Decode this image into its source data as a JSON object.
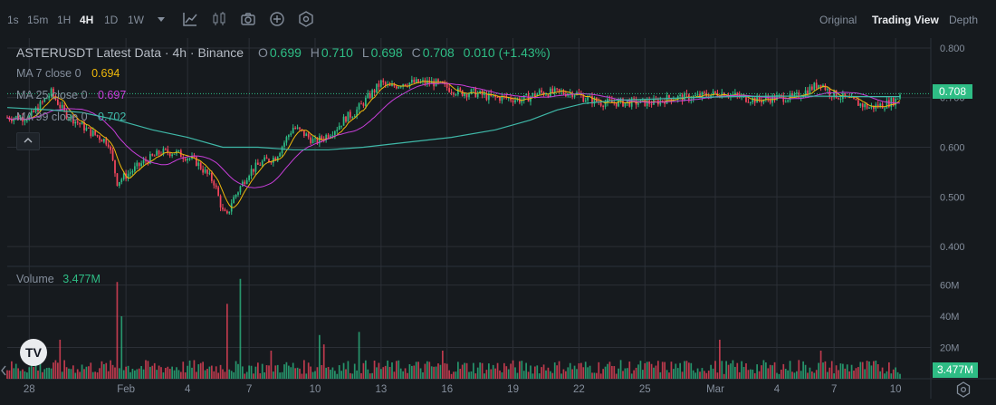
{
  "toolbar": {
    "timeframes": [
      "1s",
      "15m",
      "1H",
      "4H",
      "1D",
      "1W"
    ],
    "active_timeframe": "4H",
    "views": [
      "Original",
      "Trading View",
      "Depth"
    ],
    "active_view": "Trading View"
  },
  "legend": {
    "title": "ASTERUSDT Latest Data · 4h · Binance",
    "open_label": "O",
    "open": "0.699",
    "high_label": "H",
    "high": "0.710",
    "low_label": "L",
    "low": "0.698",
    "close_label": "C",
    "close": "0.708",
    "change": "0.010 (+1.43%)",
    "ma7_label": "MA 7 close 0",
    "ma7_value": "0.694",
    "ma25_label": "MA 25 close 0",
    "ma25_value": "0.697",
    "ma99_label": "MA 99 close 0",
    "ma99_value": "0.702",
    "volume_label": "Volume",
    "volume_value": "3.477M"
  },
  "last_price": "0.708",
  "last_volume": "3.477M",
  "colors": {
    "background": "#161a1e",
    "grid": "#2b2f36",
    "up": "#2ebd85",
    "down": "#f6465d",
    "ma7": "#f0b90b",
    "ma25": "#c73ed9",
    "ma99": "#3fb8a8"
  },
  "chart_data": {
    "type": "candlestick",
    "symbol": "ASTERUSDT",
    "interval": "4h",
    "price_axis": {
      "ticks": [
        0.8,
        0.7,
        0.6,
        0.5,
        0.4
      ],
      "tick_labels": [
        "0.800",
        "0.700",
        "0.600",
        "0.500",
        "0.400"
      ],
      "range": [
        0.36,
        0.82
      ]
    },
    "volume_axis": {
      "ticks": [
        60,
        40,
        20
      ],
      "tick_labels": [
        "60M",
        "40M",
        "20M"
      ],
      "range": [
        0,
        72
      ]
    },
    "x_labels": [
      "28",
      "Feb",
      "4",
      "7",
      "10",
      "13",
      "16",
      "19",
      "22",
      "25",
      "Mar",
      "4",
      "7",
      "10"
    ],
    "x_label_positions": [
      0,
      22,
      36,
      50,
      65,
      80,
      95,
      110,
      125,
      140,
      156,
      170,
      183,
      197
    ],
    "x_range": [
      -5,
      205
    ],
    "price_path": [
      [
        -5,
        0.66
      ],
      [
        0,
        0.66
      ],
      [
        3,
        0.69
      ],
      [
        5,
        0.71
      ],
      [
        8,
        0.67
      ],
      [
        11,
        0.65
      ],
      [
        14,
        0.63
      ],
      [
        18,
        0.61
      ],
      [
        20,
        0.53
      ],
      [
        23,
        0.55
      ],
      [
        26,
        0.57
      ],
      [
        28,
        0.58
      ],
      [
        30,
        0.59
      ],
      [
        33,
        0.59
      ],
      [
        36,
        0.58
      ],
      [
        38,
        0.57
      ],
      [
        40,
        0.55
      ],
      [
        42,
        0.53
      ],
      [
        44,
        0.47
      ],
      [
        45,
        0.46
      ],
      [
        46,
        0.49
      ],
      [
        48,
        0.52
      ],
      [
        50,
        0.55
      ],
      [
        53,
        0.57
      ],
      [
        56,
        0.58
      ],
      [
        58,
        0.61
      ],
      [
        60,
        0.64
      ],
      [
        62,
        0.63
      ],
      [
        65,
        0.61
      ],
      [
        67,
        0.62
      ],
      [
        70,
        0.64
      ],
      [
        72,
        0.66
      ],
      [
        74,
        0.67
      ],
      [
        77,
        0.7
      ],
      [
        80,
        0.73
      ],
      [
        82,
        0.72
      ],
      [
        85,
        0.73
      ],
      [
        88,
        0.73
      ],
      [
        92,
        0.73
      ],
      [
        95,
        0.72
      ],
      [
        98,
        0.71
      ],
      [
        101,
        0.71
      ],
      [
        105,
        0.7
      ],
      [
        108,
        0.7
      ],
      [
        112,
        0.695
      ],
      [
        116,
        0.71
      ],
      [
        120,
        0.71
      ],
      [
        124,
        0.71
      ],
      [
        126,
        0.7
      ],
      [
        130,
        0.69
      ],
      [
        134,
        0.69
      ],
      [
        138,
        0.69
      ],
      [
        142,
        0.69
      ],
      [
        146,
        0.7
      ],
      [
        150,
        0.7
      ],
      [
        154,
        0.705
      ],
      [
        158,
        0.71
      ],
      [
        162,
        0.7
      ],
      [
        166,
        0.695
      ],
      [
        170,
        0.7
      ],
      [
        174,
        0.7
      ],
      [
        176,
        0.71
      ],
      [
        178,
        0.72
      ],
      [
        180,
        0.73
      ],
      [
        182,
        0.71
      ],
      [
        185,
        0.7
      ],
      [
        188,
        0.69
      ],
      [
        191,
        0.68
      ],
      [
        194,
        0.685
      ],
      [
        197,
        0.695
      ],
      [
        198,
        0.708
      ]
    ],
    "volume_spikes": [
      [
        7,
        25
      ],
      [
        20,
        62
      ],
      [
        21,
        40
      ],
      [
        45,
        48
      ],
      [
        48,
        64
      ],
      [
        55,
        18
      ],
      [
        66,
        28
      ],
      [
        67,
        22
      ],
      [
        75,
        30
      ],
      [
        94,
        18
      ],
      [
        157,
        25
      ],
      [
        175,
        12
      ],
      [
        180,
        18
      ]
    ],
    "ma99_path": [
      [
        -5,
        0.68
      ],
      [
        5,
        0.675
      ],
      [
        12,
        0.67
      ],
      [
        20,
        0.655
      ],
      [
        28,
        0.635
      ],
      [
        36,
        0.62
      ],
      [
        44,
        0.6
      ],
      [
        52,
        0.6
      ],
      [
        60,
        0.595
      ],
      [
        68,
        0.595
      ],
      [
        76,
        0.6
      ],
      [
        86,
        0.61
      ],
      [
        96,
        0.62
      ],
      [
        106,
        0.635
      ],
      [
        114,
        0.655
      ],
      [
        120,
        0.675
      ],
      [
        126,
        0.688
      ],
      [
        134,
        0.695
      ],
      [
        142,
        0.697
      ],
      [
        150,
        0.7
      ],
      [
        160,
        0.702
      ],
      [
        170,
        0.703
      ],
      [
        180,
        0.703
      ],
      [
        190,
        0.702
      ],
      [
        198,
        0.702
      ]
    ]
  }
}
